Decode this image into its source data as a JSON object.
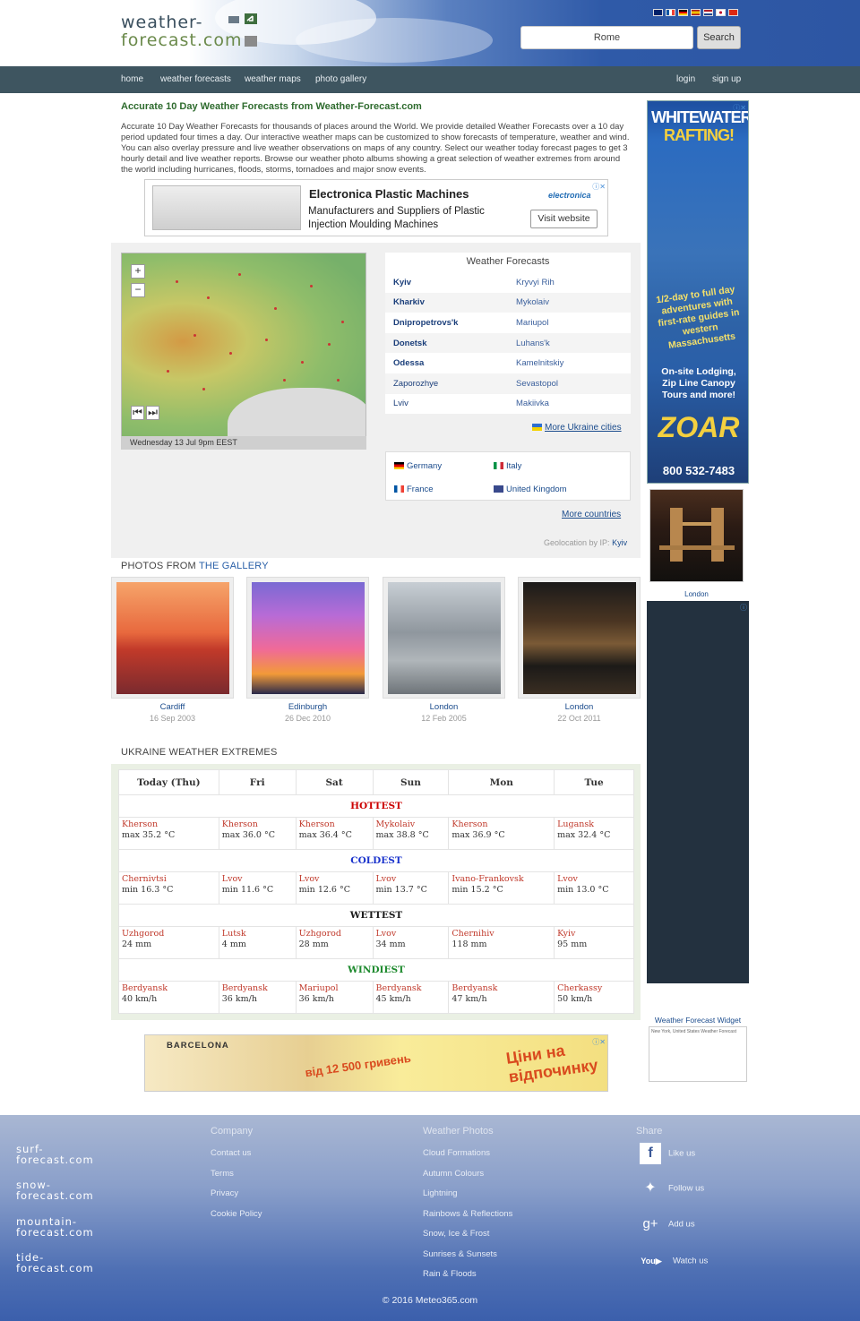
{
  "header": {
    "logo_line1": "weather-",
    "logo_line2": "forecast.com",
    "search_value": "Rome",
    "search_button": "Search",
    "flag_colors": [
      "#012169",
      "#0055a4",
      "#000000",
      "#aa151b",
      "#21468b",
      "#bc002d",
      "#de2910"
    ]
  },
  "nav": {
    "items": [
      "home",
      "weather forecasts",
      "weather maps",
      "photo gallery"
    ],
    "login": "login",
    "signup": "sign up"
  },
  "intro": {
    "title": "Accurate 10 Day Weather Forecasts from Weather-Forecast.com",
    "text": "Accurate 10 Day Weather Forecasts for thousands of places around the World. We provide detailed Weather Forecasts over a 10 day period updated four times a day. Our interactive weather maps can be customized to show forecasts of temperature, weather and wind. You can also overlay pressure and live weather observations on maps of any country. Select our weather today forecast pages to get 3 hourly detail and live weather reports. Browse our weather photo albums showing a great selection of weather extremes from around the world including hurricanes, floods, storms, tornadoes and major snow events."
  },
  "ad_top": {
    "title": "Electronica Plastic Machines",
    "subtitle": "Manufacturers and Suppliers of Plastic Injection Moulding Machines",
    "button": "Visit website",
    "brand": "electronica"
  },
  "map": {
    "caption": "Wednesday 13 Jul 9pm EEST",
    "zoom_in": "+",
    "zoom_out": "−"
  },
  "forecasts": {
    "title": "Weather Forecasts",
    "rows": [
      {
        "left": "Kyiv",
        "right": "Kryvyi Rih",
        "bold": true
      },
      {
        "left": "Kharkiv",
        "right": "Mykolaiv",
        "bold": true
      },
      {
        "left": "Dnipropetrovs'k",
        "right": "Mariupol",
        "bold": true
      },
      {
        "left": "Donetsk",
        "right": "Luhans'k",
        "bold": true
      },
      {
        "left": "Odessa",
        "right": "Kamelnitskiy",
        "bold": true
      },
      {
        "left": "Zaporozhye",
        "right": "Sevastopol",
        "bold": false
      },
      {
        "left": "Lviv",
        "right": "Makiivka",
        "bold": false
      }
    ],
    "more_cities": "More Ukraine cities",
    "countries": [
      "Germany",
      "Italy",
      "France",
      "United Kingdom"
    ],
    "more_countries": "More countries",
    "geo_label": "Geolocation by IP:",
    "geo_city": "Kyiv"
  },
  "gallery": {
    "title_prefix": "PHOTOS FROM ",
    "title_link": "THE GALLERY",
    "photos": [
      {
        "place": "Cardiff",
        "date": "16 Sep 2003"
      },
      {
        "place": "Edinburgh",
        "date": "26 Dec 2010"
      },
      {
        "place": "London",
        "date": "12 Feb 2005"
      },
      {
        "place": "London",
        "date": "22 Oct 2011"
      }
    ]
  },
  "extremes": {
    "title": "UKRAINE WEATHER EXTREMES",
    "days": [
      "Today (Thu)",
      "Fri",
      "Sat",
      "Sun",
      "Mon",
      "Tue"
    ],
    "sections": [
      {
        "label": "HOTTEST",
        "color": "#cc0000",
        "cells": [
          [
            "Kherson",
            "max 35.2 °C"
          ],
          [
            "Kherson",
            "max 36.0 °C"
          ],
          [
            "Kherson",
            "max 36.4 °C"
          ],
          [
            "Mykolaiv",
            "max 38.8 °C"
          ],
          [
            "Kherson",
            "max 36.9 °C"
          ],
          [
            "Lugansk",
            "max 32.4 °C"
          ]
        ]
      },
      {
        "label": "COLDEST",
        "color": "#1a33cc",
        "cells": [
          [
            "Chernivtsi",
            "min 16.3 °C"
          ],
          [
            "Lvov",
            "min 11.6 °C"
          ],
          [
            "Lvov",
            "min 12.6 °C"
          ],
          [
            "Lvov",
            "min 13.7 °C"
          ],
          [
            "Ivano-Frankovsk",
            "min 15.2 °C"
          ],
          [
            "Lvov",
            "min 13.0 °C"
          ]
        ]
      },
      {
        "label": "WETTEST",
        "color": "#1a1a1a",
        "cells": [
          [
            "Uzhgorod",
            "24 mm"
          ],
          [
            "Lutsk",
            "4 mm"
          ],
          [
            "Uzhgorod",
            "28 mm"
          ],
          [
            "Lvov",
            "34 mm"
          ],
          [
            "Chernihiv",
            "118 mm"
          ],
          [
            "Kyiv",
            "95 mm"
          ]
        ]
      },
      {
        "label": "WINDIEST",
        "color": "#1e8a2e",
        "cells": [
          [
            "Berdyansk",
            "40 km/h"
          ],
          [
            "Berdyansk",
            "36 km/h"
          ],
          [
            "Mariupol",
            "36 km/h"
          ],
          [
            "Berdyansk",
            "45 km/h"
          ],
          [
            "Berdyansk",
            "47 km/h"
          ],
          [
            "Cherkassy",
            "50 km/h"
          ]
        ]
      }
    ]
  },
  "ad_bottom": {
    "brand": "BARCELONA",
    "price": "від 12 500 гривень",
    "slogan": "Ціни на відпочинку"
  },
  "sidebar": {
    "ad_title1": "WHITEWATER",
    "ad_title2": "RAFTING!",
    "ad_text1": "1/2-day to full day adventures with first-rate guides in western Massachusetts",
    "ad_text2": "On-site Lodging, Zip Line Canopy Tours and more!",
    "ad_brand": "ZOAR",
    "ad_phone": "800 532-7483",
    "photo_caption": "London",
    "widget_title": "Weather Forecast Widget",
    "widget_text": "New York, United States Weather Forecast"
  },
  "footer": {
    "logos": [
      [
        "surf-",
        "forecast.com"
      ],
      [
        "snow-",
        "forecast.com"
      ],
      [
        "mountain-",
        "forecast.com"
      ],
      [
        "tide-",
        "forecast.com"
      ]
    ],
    "company_title": "Company",
    "company_items": [
      "Contact us",
      "Terms",
      "Privacy",
      "Cookie Policy"
    ],
    "photos_title": "Weather Photos",
    "photos_items": [
      "Cloud Formations",
      "Autumn Colours",
      "Lightning",
      "Rainbows & Reflections",
      "Snow, Ice & Frost",
      "Sunrises & Sunsets",
      "Rain & Floods"
    ],
    "share_title": "Share",
    "share_items": [
      "Like us",
      "Follow us",
      "Add us",
      "Watch us"
    ],
    "copyright": "© 2016 Meteo365.com"
  }
}
